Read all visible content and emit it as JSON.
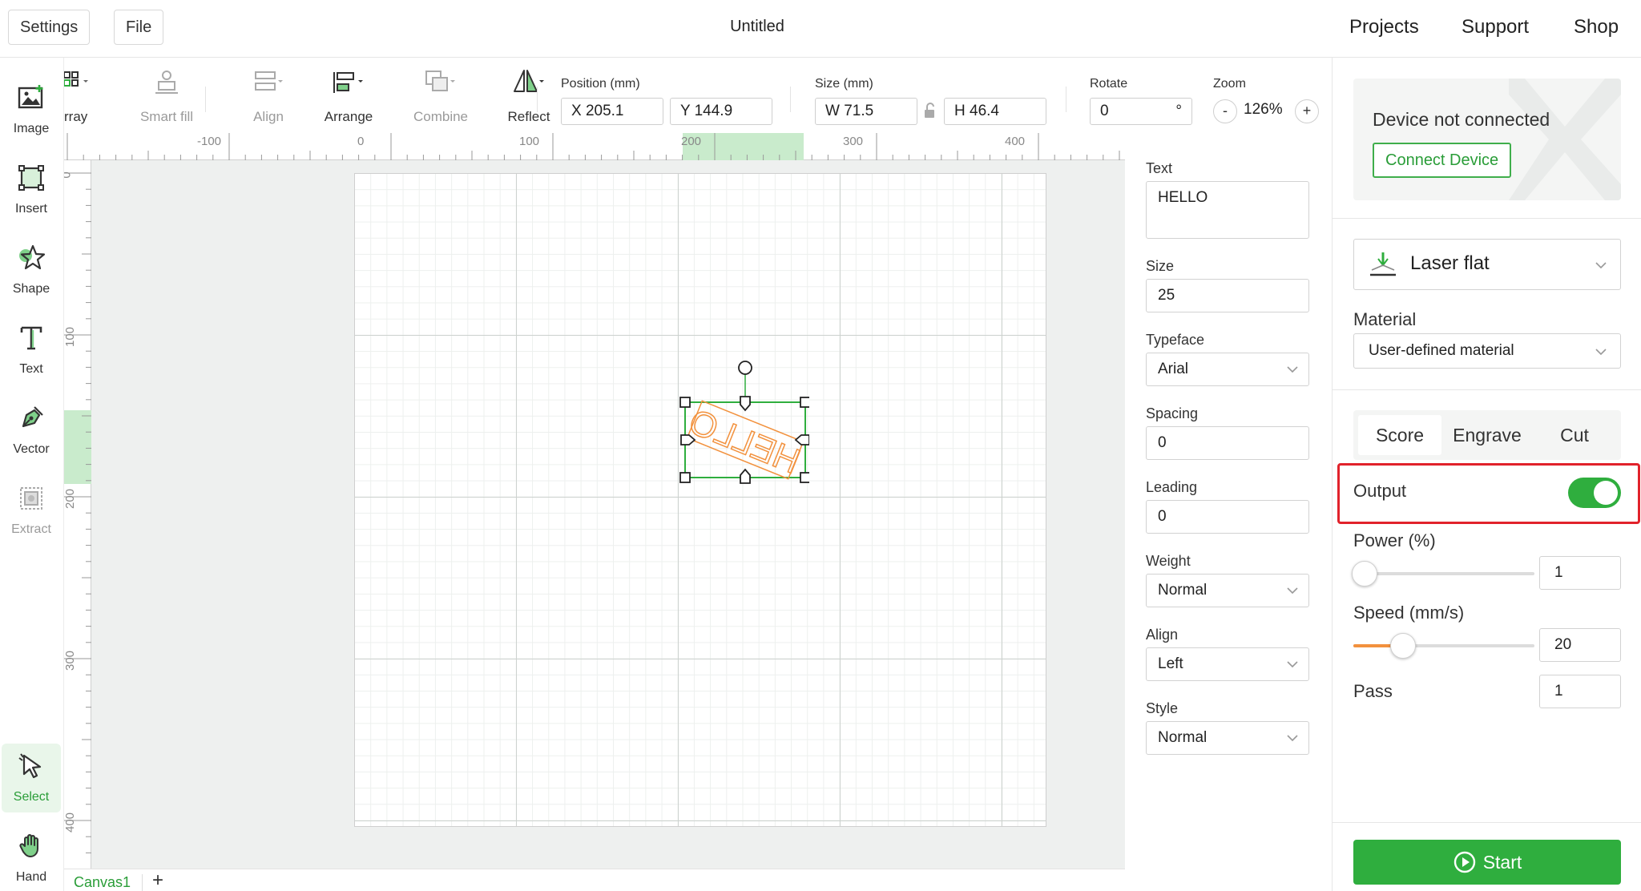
{
  "topbar": {
    "settings_label": "Settings",
    "file_label": "File",
    "title": "Untitled",
    "projects_label": "Projects",
    "support_label": "Support",
    "shop_label": "Shop"
  },
  "left_tools": {
    "image": "Image",
    "insert": "Insert",
    "shape": "Shape",
    "text": "Text",
    "vector": "Vector",
    "extract": "Extract",
    "select": "Select",
    "hand": "Hand"
  },
  "prop_toolbar": {
    "array": "rray",
    "smart_fill": "Smart fill",
    "align": "Align",
    "arrange": "Arrange",
    "combine": "Combine",
    "reflect": "Reflect",
    "position_label": "Position (mm)",
    "x_value": "X 205.1",
    "y_value": "Y 144.9",
    "size_label": "Size (mm)",
    "w_value": "W 71.5",
    "h_value": "H 46.4",
    "rotate_label": "Rotate",
    "rotate_value": "0",
    "rotate_unit": "°",
    "zoom_label": "Zoom",
    "zoom_minus": "-",
    "zoom_value": "126%",
    "zoom_plus": "+"
  },
  "ruler": {
    "h_labels": [
      "-100",
      "0",
      "100",
      "200",
      "300",
      "400"
    ],
    "v_labels": [
      "0",
      "100",
      "200",
      "300",
      "400"
    ]
  },
  "canvas": {
    "object_text": "HELLO",
    "tab_name": "Canvas1",
    "add_tab": "+"
  },
  "text_panel": {
    "text_label": "Text",
    "text_value": "HELLO",
    "size_label": "Size",
    "size_value": "25",
    "typeface_label": "Typeface",
    "typeface_value": "Arial",
    "spacing_label": "Spacing",
    "spacing_value": "0",
    "leading_label": "Leading",
    "leading_value": "0",
    "weight_label": "Weight",
    "weight_value": "Normal",
    "align_label": "Align",
    "align_value": "Left",
    "style_label": "Style",
    "style_value": "Normal"
  },
  "right_panel": {
    "device_status": "Device not connected",
    "connect_label": "Connect Device",
    "mode": "Laser flat",
    "material_label": "Material",
    "material_value": "User-defined material",
    "tabs": [
      "Score",
      "Engrave",
      "Cut"
    ],
    "output_label": "Output",
    "output_on": true,
    "power_label": "Power (%)",
    "power_value": "1",
    "speed_label": "Speed (mm/s)",
    "speed_value": "20",
    "pass_label": "Pass",
    "pass_value": "1",
    "start_label": "Start"
  },
  "colors": {
    "accent": "#2fae3e",
    "highlight_box": "#e1222b",
    "text_object": "#f2913d",
    "slider_fill": "#f2913d"
  }
}
